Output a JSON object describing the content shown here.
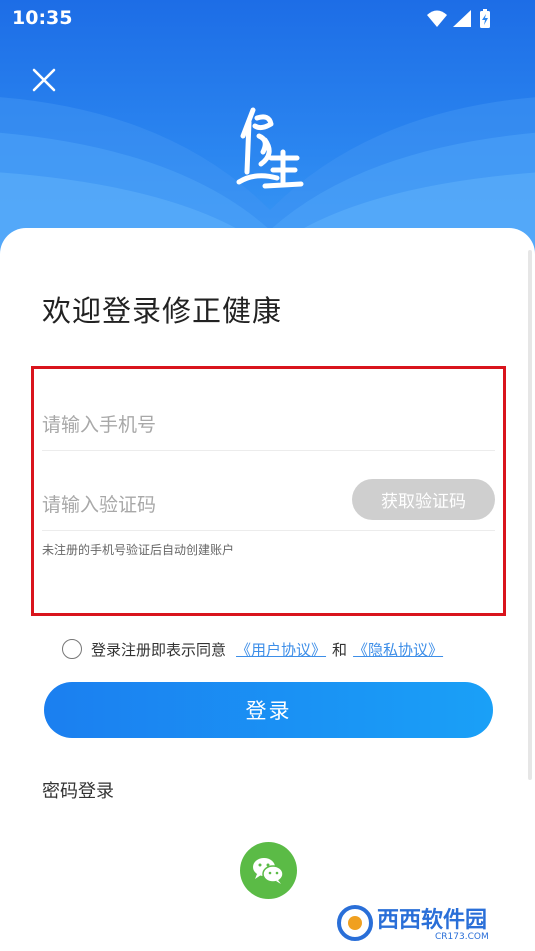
{
  "status_bar": {
    "time": "10:35",
    "icons": [
      "wifi-icon",
      "signal-icon",
      "battery-icon"
    ]
  },
  "header": {
    "close_icon": "close-icon",
    "logo_text": "修正",
    "brand_color": "#2b86f0"
  },
  "main": {
    "welcome_title": "欢迎登录修正健康",
    "phone_placeholder": "请输入手机号",
    "phone_value": "",
    "code_placeholder": "请输入验证码",
    "code_value": "",
    "get_code_label": "获取验证码",
    "hint": "未注册的手机号验证后自动创建账户"
  },
  "agreement": {
    "prefix": "登录注册即表示同意",
    "user_agreement": "《用户协议》",
    "and": "和",
    "privacy_policy": "《隐私协议》",
    "checked": false
  },
  "login_button_label": "登录",
  "password_login_label": "密码登录",
  "wechat_icon": "wechat-icon",
  "watermark": {
    "text": "西西软件园",
    "sub": "CR173.COM"
  },
  "colors": {
    "accent": "#1b8ef3",
    "link": "#3d8ee8",
    "highlight_box": "#d9141c",
    "wechat": "#5bbb46"
  }
}
